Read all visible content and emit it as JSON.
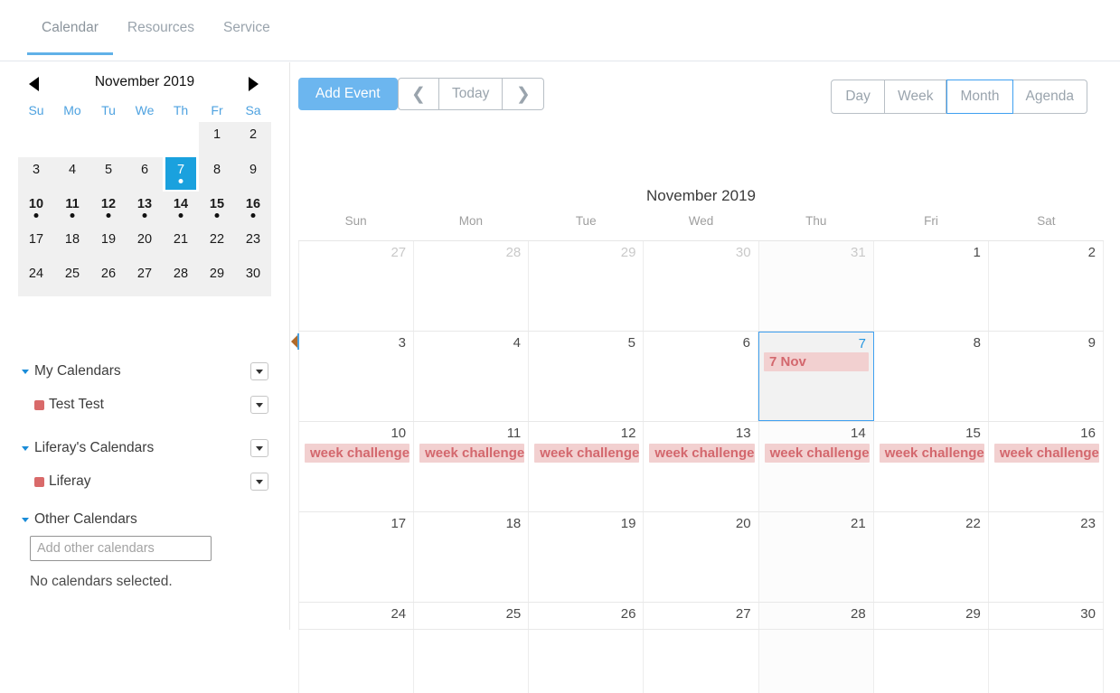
{
  "tabs": [
    {
      "label": "Calendar",
      "active": true
    },
    {
      "label": "Resources",
      "active": false
    },
    {
      "label": "Service",
      "active": false
    }
  ],
  "sidebar": {
    "mini_calendar": {
      "title": "November 2019",
      "prev_icon": "triangle-left-icon",
      "next_icon": "triangle-right-icon",
      "dow": [
        "Su",
        "Mo",
        "Tu",
        "We",
        "Th",
        "Fr",
        "Sa"
      ],
      "weeks": [
        [
          {
            "day": "",
            "blank": true
          },
          {
            "day": "",
            "blank": true
          },
          {
            "day": "",
            "blank": true
          },
          {
            "day": "",
            "blank": true
          },
          {
            "day": "",
            "blank": true
          },
          {
            "day": "1"
          },
          {
            "day": "2"
          }
        ],
        [
          {
            "day": "3"
          },
          {
            "day": "4"
          },
          {
            "day": "5"
          },
          {
            "day": "6"
          },
          {
            "day": "7",
            "today": true,
            "dot": true
          },
          {
            "day": "8"
          },
          {
            "day": "9"
          }
        ],
        [
          {
            "day": "10",
            "bold": true,
            "dot": true
          },
          {
            "day": "11",
            "bold": true,
            "dot": true
          },
          {
            "day": "12",
            "bold": true,
            "dot": true
          },
          {
            "day": "13",
            "bold": true,
            "dot": true
          },
          {
            "day": "14",
            "bold": true,
            "dot": true
          },
          {
            "day": "15",
            "bold": true,
            "dot": true
          },
          {
            "day": "16",
            "bold": true,
            "dot": true
          }
        ],
        [
          {
            "day": "17"
          },
          {
            "day": "18"
          },
          {
            "day": "19"
          },
          {
            "day": "20"
          },
          {
            "day": "21"
          },
          {
            "day": "22"
          },
          {
            "day": "23"
          }
        ],
        [
          {
            "day": "24"
          },
          {
            "day": "25"
          },
          {
            "day": "26"
          },
          {
            "day": "27"
          },
          {
            "day": "28"
          },
          {
            "day": "29"
          },
          {
            "day": "30"
          }
        ]
      ]
    },
    "sections": [
      {
        "title": "My Calendars",
        "caret_icon": "caret-down-icon",
        "menu_icon": "dropdown-caret-icon",
        "items": [
          {
            "label": "Test Test",
            "color": "#d96a6a",
            "menu_icon": "dropdown-caret-icon"
          }
        ]
      },
      {
        "title": "Liferay's Calendars",
        "caret_icon": "caret-down-icon",
        "menu_icon": "dropdown-caret-icon",
        "items": [
          {
            "label": "Liferay",
            "color": "#d96a6a",
            "menu_icon": "dropdown-caret-icon"
          }
        ]
      }
    ],
    "other_calendars": {
      "title": "Other Calendars",
      "caret_icon": "caret-down-icon",
      "input_placeholder": "Add other calendars",
      "input_value": "",
      "empty_message": "No calendars selected."
    },
    "collapse_icon": "triangle-left-icon"
  },
  "toolbar": {
    "add_event_label": "Add Event",
    "prev_icon": "chevron-left-icon",
    "today_label": "Today",
    "next_icon": "chevron-right-icon",
    "views": [
      {
        "label": "Day",
        "active": false
      },
      {
        "label": "Week",
        "active": false
      },
      {
        "label": "Month",
        "active": true
      },
      {
        "label": "Agenda",
        "active": false
      }
    ]
  },
  "calendar": {
    "month_title": "November 2019",
    "dow": [
      "Sun",
      "Mon",
      "Tue",
      "Wed",
      "Thu",
      "Fri",
      "Sat"
    ],
    "accent_color": "#3fa0f0",
    "event_bg": "#f2d0d0",
    "event_fg": "#d3676d",
    "weeks": [
      [
        {
          "day": "27",
          "other": true
        },
        {
          "day": "28",
          "other": true
        },
        {
          "day": "29",
          "other": true
        },
        {
          "day": "30",
          "other": true
        },
        {
          "day": "31",
          "other": true
        },
        {
          "day": "1"
        },
        {
          "day": "2"
        }
      ],
      [
        {
          "day": "3"
        },
        {
          "day": "4"
        },
        {
          "day": "5"
        },
        {
          "day": "6"
        },
        {
          "day": "7",
          "today": true,
          "event": "7 Nov"
        },
        {
          "day": "8"
        },
        {
          "day": "9"
        }
      ],
      [
        {
          "day": "10",
          "event": "week challenge"
        },
        {
          "day": "11",
          "event": "week challenge"
        },
        {
          "day": "12",
          "event": "week challenge"
        },
        {
          "day": "13",
          "event": "week challenge"
        },
        {
          "day": "14",
          "event": "week challenge"
        },
        {
          "day": "15",
          "event": "week challenge"
        },
        {
          "day": "16",
          "event": "week challenge"
        }
      ],
      [
        {
          "day": "17"
        },
        {
          "day": "18"
        },
        {
          "day": "19"
        },
        {
          "day": "20"
        },
        {
          "day": "21"
        },
        {
          "day": "22"
        },
        {
          "day": "23"
        }
      ],
      [
        {
          "day": "24"
        },
        {
          "day": "25"
        },
        {
          "day": "26"
        },
        {
          "day": "27"
        },
        {
          "day": "28"
        },
        {
          "day": "29"
        },
        {
          "day": "30"
        }
      ]
    ]
  }
}
